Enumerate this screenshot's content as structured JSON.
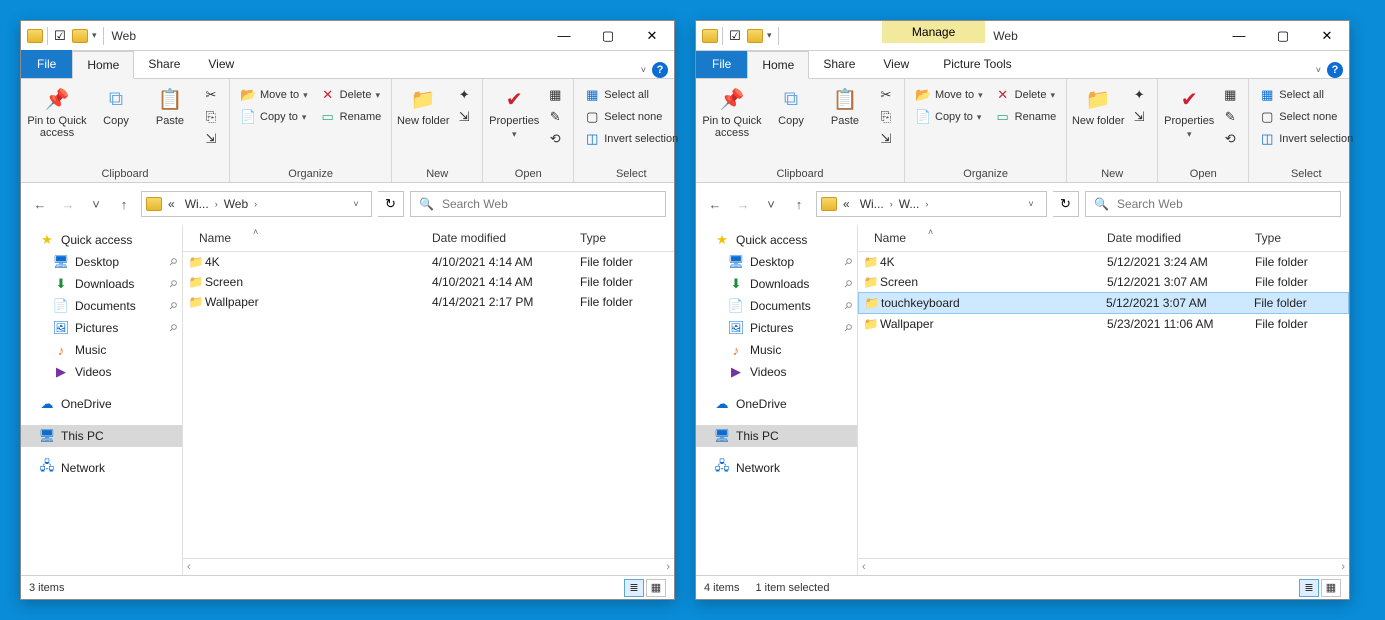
{
  "title_left": "Web",
  "title_right": "Web",
  "contextual_label": "Manage",
  "contextual_tool": "Picture Tools",
  "tabs": {
    "file": "File",
    "home": "Home",
    "share": "Share",
    "view": "View"
  },
  "ribbon": {
    "pin": "Pin to Quick access",
    "copy": "Copy",
    "paste": "Paste",
    "clipboard": "Clipboard",
    "moveto": "Move to",
    "copyto": "Copy to",
    "delete": "Delete",
    "rename": "Rename",
    "organize": "Organize",
    "newfolder": "New folder",
    "new": "New",
    "properties": "Properties",
    "open": "Open",
    "selectall": "Select all",
    "selectnone": "Select none",
    "invert": "Invert selection",
    "select": "Select"
  },
  "addr_left": {
    "s1": "«",
    "s2": "Wi...",
    "s3": "Web"
  },
  "addr_right": {
    "s1": "«",
    "s2": "Wi...",
    "s3": "W..."
  },
  "search_placeholder": "Search Web",
  "sidebar": {
    "quick": "Quick access",
    "desktop": "Desktop",
    "downloads": "Downloads",
    "documents": "Documents",
    "pictures": "Pictures",
    "music": "Music",
    "videos": "Videos",
    "onedrive": "OneDrive",
    "thispc": "This PC",
    "network": "Network"
  },
  "cols": {
    "name": "Name",
    "date": "Date modified",
    "type": "Type"
  },
  "left_rows": [
    {
      "n": "4K",
      "d": "4/10/2021 4:14 AM",
      "t": "File folder"
    },
    {
      "n": "Screen",
      "d": "4/10/2021 4:14 AM",
      "t": "File folder"
    },
    {
      "n": "Wallpaper",
      "d": "4/14/2021 2:17 PM",
      "t": "File folder"
    }
  ],
  "right_rows": [
    {
      "n": "4K",
      "d": "5/12/2021 3:24 AM",
      "t": "File folder",
      "sel": false
    },
    {
      "n": "Screen",
      "d": "5/12/2021 3:07 AM",
      "t": "File folder",
      "sel": false
    },
    {
      "n": "touchkeyboard",
      "d": "5/12/2021 3:07 AM",
      "t": "File folder",
      "sel": true
    },
    {
      "n": "Wallpaper",
      "d": "5/23/2021 11:06 AM",
      "t": "File folder",
      "sel": false
    }
  ],
  "status_left": "3 items",
  "status_right_items": "4 items",
  "status_right_sel": "1 item selected"
}
